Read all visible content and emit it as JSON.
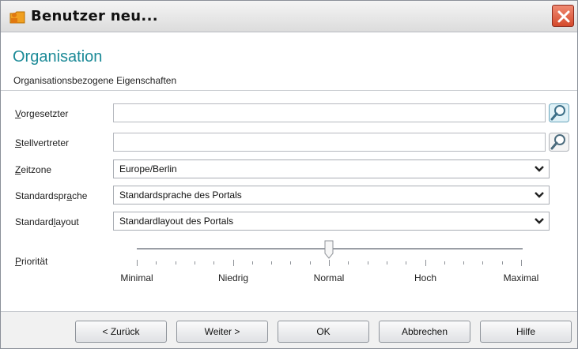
{
  "window": {
    "title": "Benutzer neu...",
    "app_icon": "folder-user-icon",
    "close_icon": "close-icon"
  },
  "header": {
    "title": "Organisation",
    "subtitle": "Organisationsbezogene Eigenschaften"
  },
  "fields": {
    "vorgesetzter": {
      "label": "Vorgesetzter",
      "value": "",
      "icon": "search-icon"
    },
    "stellvertreter": {
      "label": "Stellvertreter",
      "value": "",
      "icon": "search-icon"
    },
    "zeitzone": {
      "label": "Zeitzone",
      "value": "Europe/Berlin"
    },
    "standardsprache": {
      "label": "Standardsprache",
      "value": "Standardsprache des Portals"
    },
    "standardlayout": {
      "label": "Standardlayout",
      "value": "Standardlayout des Portals"
    }
  },
  "priority": {
    "label": "Priorität",
    "levels": [
      "Minimal",
      "Niedrig",
      "Normal",
      "Hoch",
      "Maximal"
    ],
    "selected": "Normal"
  },
  "buttons": {
    "back": "< Zurück",
    "next": "Weiter >",
    "ok": "OK",
    "cancel": "Abbrechen",
    "help": "Hilfe"
  },
  "colors": {
    "heading": "#1b8a97",
    "close": "#d44a2c"
  }
}
